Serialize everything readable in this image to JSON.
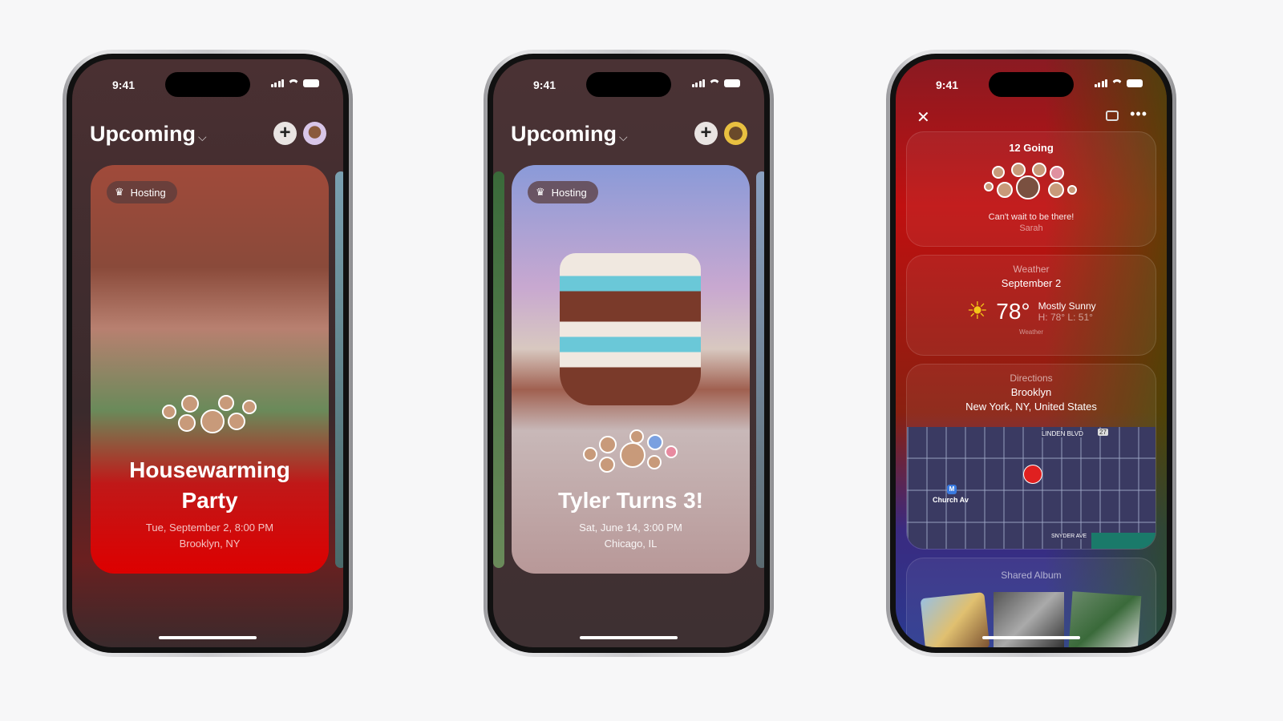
{
  "status_bar": {
    "time": "9:41"
  },
  "phones": [
    {
      "header": {
        "title": "Upcoming"
      },
      "event": {
        "badge": "Hosting",
        "title_line1": "Housewarming",
        "title_line2": "Party",
        "date": "Tue, September 2, 8:00 PM",
        "location": "Brooklyn, NY"
      }
    },
    {
      "header": {
        "title": "Upcoming"
      },
      "event": {
        "badge": "Hosting",
        "title": "Tyler Turns 3!",
        "date": "Sat, June 14, 3:00 PM",
        "location": "Chicago, IL"
      }
    },
    {
      "attendees": {
        "count_label": "12 Going",
        "message": "Can't wait to be there!",
        "author": "Sarah"
      },
      "weather": {
        "label": "Weather",
        "date": "September 2",
        "temperature": "78°",
        "condition": "Mostly Sunny",
        "high_low": "H: 78° L: 51°",
        "provider": "Weather",
        "icon": "sun-icon"
      },
      "directions": {
        "label": "Directions",
        "place": "Brooklyn",
        "address": "New York, NY, United States",
        "map_labels": {
          "street1": "LINDEN BLVD",
          "route": "27",
          "street2": "SNYDER AVE",
          "station_icon": "M",
          "station": "Church Av"
        }
      },
      "shared_album": {
        "label": "Shared Album"
      }
    }
  ],
  "colors": {
    "accent_red": "#d0101a",
    "screen_bg": "#4a3234"
  }
}
